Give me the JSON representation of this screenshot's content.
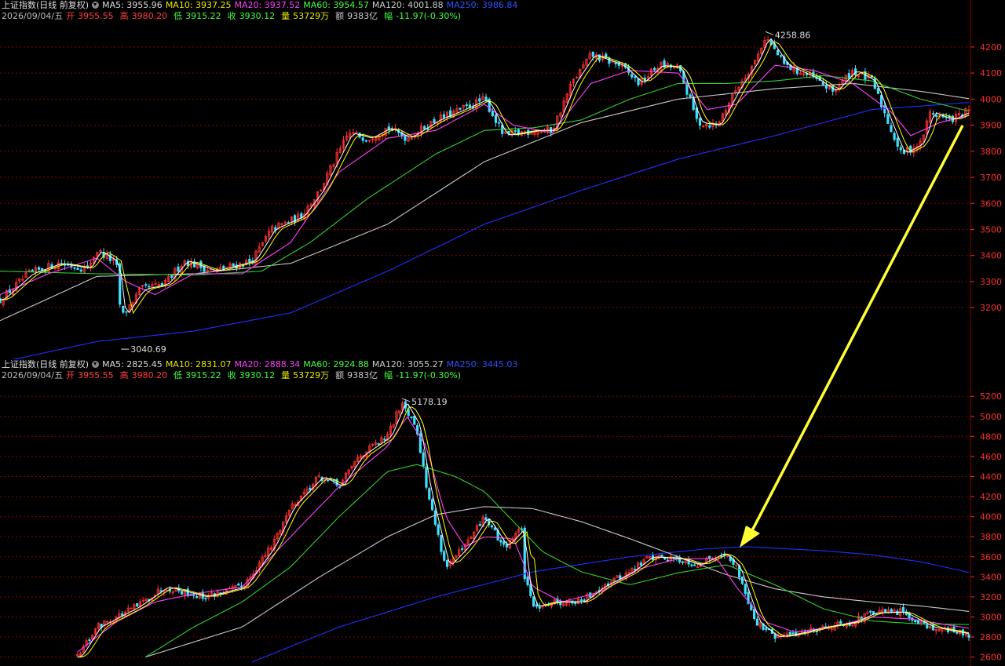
{
  "colors": {
    "background": "#000000",
    "up": "#ff3030",
    "down": "#40e0ff",
    "ma5": "#ffffff",
    "ma10": "#ffff00",
    "ma20": "#ff40ff",
    "ma60": "#30d030",
    "ma120": "#c8c8c8",
    "ma250": "#2030ff",
    "grid": "#8b0000",
    "axis_text": "#ff3030",
    "arrow": "#ffff33"
  },
  "panel1": {
    "title": "上证指数(日线 前复权)",
    "ma5": "MA5: 3955.96",
    "ma10": "MA10: 3937.25",
    "ma20": "MA20: 3937.52",
    "ma60": "MA60: 3954.57",
    "ma120": "MA120: 4001.88",
    "ma250": "MA250: 3986.84",
    "date": "2026/09/04/五",
    "open_label": "开",
    "open": "3955.55",
    "high_label": "高",
    "high": "3980.20",
    "low_label": "低",
    "low": "3915.22",
    "close_label": "收",
    "close": "3930.12",
    "vol_label": "量",
    "vol": "53729万",
    "amt_label": "额",
    "amt": "9383亿",
    "chg_label": "幅",
    "chg": "-11.97(-0.30%)",
    "max_label": "4258.86",
    "min_label": "3040.69"
  },
  "panel2": {
    "title": "上证指数(日线 前复权)",
    "ma5": "MA5: 2825.45",
    "ma10": "MA10: 2831.07",
    "ma20": "MA20: 2888.34",
    "ma60": "MA60: 2924.88",
    "ma120": "MA120: 3055.27",
    "ma250": "MA250: 3445.03",
    "date": "2026/09/04/五",
    "open_label": "开",
    "open": "3955.55",
    "high_label": "高",
    "high": "3980.20",
    "low_label": "低",
    "low": "3915.22",
    "close_label": "收",
    "close": "3930.12",
    "vol_label": "量",
    "vol": "53729万",
    "amt_label": "额",
    "amt": "9383亿",
    "chg_label": "幅",
    "chg": "-11.97(-0.30%)",
    "max_label": "5178.19"
  },
  "chart_data": [
    {
      "type": "candlestick",
      "title": "上证指数(日线 前复权)",
      "ylim": [
        3050,
        4290
      ],
      "yticks": [
        3200,
        3300,
        3400,
        3500,
        3600,
        3700,
        3800,
        3900,
        4000,
        4100,
        4200
      ],
      "ytick_labels": [
        "3200",
        "3300",
        "3400",
        "3500",
        "3600",
        "3700",
        "3800",
        "3900",
        "4000",
        "4100",
        "4200"
      ],
      "grid": true,
      "max_point": {
        "i": 0.79,
        "value": 4258.86,
        "label": "4258.86"
      },
      "min_point": {
        "i": 0.125,
        "value": 3040.69,
        "label": "3040.69"
      },
      "close_path": [
        [
          0,
          3230
        ],
        [
          0.03,
          3330
        ],
        [
          0.06,
          3370
        ],
        [
          0.09,
          3350
        ],
        [
          0.1,
          3420
        ],
        [
          0.12,
          3370
        ],
        [
          0.125,
          3160
        ],
        [
          0.145,
          3270
        ],
        [
          0.17,
          3290
        ],
        [
          0.19,
          3380
        ],
        [
          0.22,
          3340
        ],
        [
          0.26,
          3380
        ],
        [
          0.28,
          3500
        ],
        [
          0.31,
          3550
        ],
        [
          0.33,
          3650
        ],
        [
          0.36,
          3870
        ],
        [
          0.38,
          3850
        ],
        [
          0.4,
          3890
        ],
        [
          0.42,
          3850
        ],
        [
          0.45,
          3920
        ],
        [
          0.47,
          3950
        ],
        [
          0.5,
          4000
        ],
        [
          0.52,
          3860
        ],
        [
          0.55,
          3880
        ],
        [
          0.57,
          3880
        ],
        [
          0.59,
          4060
        ],
        [
          0.61,
          4170
        ],
        [
          0.64,
          4130
        ],
        [
          0.66,
          4060
        ],
        [
          0.68,
          4130
        ],
        [
          0.7,
          4120
        ],
        [
          0.71,
          4020
        ],
        [
          0.72,
          3910
        ],
        [
          0.74,
          3900
        ],
        [
          0.76,
          4040
        ],
        [
          0.78,
          4150
        ],
        [
          0.79,
          4240
        ],
        [
          0.81,
          4130
        ],
        [
          0.84,
          4080
        ],
        [
          0.86,
          4030
        ],
        [
          0.88,
          4110
        ],
        [
          0.9,
          4070
        ],
        [
          0.92,
          3880
        ],
        [
          0.93,
          3790
        ],
        [
          0.95,
          3830
        ],
        [
          0.96,
          3950
        ],
        [
          0.98,
          3920
        ],
        [
          1.0,
          3955
        ]
      ],
      "ma20_path": [
        [
          0,
          3250
        ],
        [
          0.05,
          3330
        ],
        [
          0.1,
          3390
        ],
        [
          0.13,
          3300
        ],
        [
          0.16,
          3250
        ],
        [
          0.2,
          3330
        ],
        [
          0.25,
          3330
        ],
        [
          0.3,
          3450
        ],
        [
          0.35,
          3720
        ],
        [
          0.4,
          3850
        ],
        [
          0.45,
          3880
        ],
        [
          0.5,
          3980
        ],
        [
          0.53,
          3900
        ],
        [
          0.57,
          3870
        ],
        [
          0.61,
          4060
        ],
        [
          0.65,
          4110
        ],
        [
          0.7,
          4100
        ],
        [
          0.73,
          3960
        ],
        [
          0.76,
          3980
        ],
        [
          0.8,
          4130
        ],
        [
          0.84,
          4110
        ],
        [
          0.88,
          4060
        ],
        [
          0.92,
          3950
        ],
        [
          0.94,
          3860
        ],
        [
          0.97,
          3910
        ],
        [
          1.0,
          3937
        ]
      ],
      "ma60_path": [
        [
          0,
          3340
        ],
        [
          0.1,
          3330
        ],
        [
          0.2,
          3325
        ],
        [
          0.27,
          3340
        ],
        [
          0.32,
          3450
        ],
        [
          0.38,
          3620
        ],
        [
          0.45,
          3790
        ],
        [
          0.5,
          3880
        ],
        [
          0.55,
          3890
        ],
        [
          0.6,
          3920
        ],
        [
          0.65,
          4000
        ],
        [
          0.7,
          4060
        ],
        [
          0.75,
          4060
        ],
        [
          0.8,
          4070
        ],
        [
          0.85,
          4090
        ],
        [
          0.9,
          4070
        ],
        [
          0.95,
          4000
        ],
        [
          1.0,
          3954
        ]
      ],
      "ma120_path": [
        [
          0,
          3150
        ],
        [
          0.1,
          3320
        ],
        [
          0.2,
          3330
        ],
        [
          0.3,
          3370
        ],
        [
          0.4,
          3520
        ],
        [
          0.5,
          3760
        ],
        [
          0.6,
          3910
        ],
        [
          0.7,
          4000
        ],
        [
          0.8,
          4040
        ],
        [
          0.88,
          4060
        ],
        [
          0.95,
          4030
        ],
        [
          1.0,
          4002
        ]
      ],
      "ma250_path": [
        [
          0,
          2990
        ],
        [
          0.1,
          3070
        ],
        [
          0.2,
          3110
        ],
        [
          0.3,
          3180
        ],
        [
          0.4,
          3340
        ],
        [
          0.5,
          3520
        ],
        [
          0.6,
          3650
        ],
        [
          0.7,
          3770
        ],
        [
          0.8,
          3860
        ],
        [
          0.9,
          3960
        ],
        [
          1.0,
          3987
        ]
      ]
    },
    {
      "type": "candlestick",
      "title": "上证指数(日线 前复权)",
      "ylim": [
        2550,
        5350
      ],
      "yticks": [
        2600,
        2800,
        3000,
        3200,
        3400,
        3600,
        3800,
        4000,
        4200,
        4400,
        4600,
        4800,
        5000,
        5200
      ],
      "ytick_labels": [
        "2600",
        "2800",
        "3000",
        "3200",
        "3400",
        "3600",
        "3800",
        "4000",
        "4200",
        "4400",
        "4600",
        "4800",
        "5000",
        "5200"
      ],
      "grid": true,
      "max_point": {
        "i": 0.415,
        "value": 5178.19,
        "label": "5178.19"
      },
      "close_path": [
        [
          0.08,
          2600
        ],
        [
          0.1,
          2900
        ],
        [
          0.12,
          3000
        ],
        [
          0.14,
          3100
        ],
        [
          0.17,
          3300
        ],
        [
          0.19,
          3250
        ],
        [
          0.21,
          3200
        ],
        [
          0.23,
          3250
        ],
        [
          0.25,
          3300
        ],
        [
          0.28,
          3700
        ],
        [
          0.3,
          4100
        ],
        [
          0.33,
          4400
        ],
        [
          0.35,
          4300
        ],
        [
          0.37,
          4600
        ],
        [
          0.4,
          4800
        ],
        [
          0.415,
          5150
        ],
        [
          0.43,
          4900
        ],
        [
          0.44,
          4300
        ],
        [
          0.45,
          3900
        ],
        [
          0.46,
          3500
        ],
        [
          0.48,
          3700
        ],
        [
          0.5,
          4000
        ],
        [
          0.52,
          3700
        ],
        [
          0.54,
          3900
        ],
        [
          0.53,
          3800
        ],
        [
          0.55,
          3100
        ],
        [
          0.57,
          3150
        ],
        [
          0.6,
          3150
        ],
        [
          0.62,
          3300
        ],
        [
          0.65,
          3450
        ],
        [
          0.67,
          3600
        ],
        [
          0.7,
          3580
        ],
        [
          0.72,
          3520
        ],
        [
          0.745,
          3640
        ],
        [
          0.76,
          3500
        ],
        [
          0.78,
          2950
        ],
        [
          0.8,
          2800
        ],
        [
          0.82,
          2830
        ],
        [
          0.85,
          2900
        ],
        [
          0.88,
          2950
        ],
        [
          0.9,
          3040
        ],
        [
          0.93,
          3050
        ],
        [
          0.96,
          2900
        ],
        [
          1.0,
          2825
        ]
      ],
      "ma20_path": [
        [
          0.08,
          2650
        ],
        [
          0.12,
          2950
        ],
        [
          0.16,
          3150
        ],
        [
          0.2,
          3230
        ],
        [
          0.25,
          3300
        ],
        [
          0.3,
          3800
        ],
        [
          0.35,
          4300
        ],
        [
          0.4,
          4700
        ],
        [
          0.42,
          5000
        ],
        [
          0.44,
          4700
        ],
        [
          0.46,
          4000
        ],
        [
          0.48,
          3700
        ],
        [
          0.5,
          3800
        ],
        [
          0.53,
          3780
        ],
        [
          0.55,
          3300
        ],
        [
          0.58,
          3150
        ],
        [
          0.62,
          3250
        ],
        [
          0.66,
          3480
        ],
        [
          0.7,
          3580
        ],
        [
          0.74,
          3580
        ],
        [
          0.76,
          3300
        ],
        [
          0.79,
          2950
        ],
        [
          0.82,
          2850
        ],
        [
          0.86,
          2900
        ],
        [
          0.9,
          3000
        ],
        [
          0.94,
          2980
        ],
        [
          1.0,
          2888
        ]
      ],
      "ma60_path": [
        [
          0.15,
          2600
        ],
        [
          0.2,
          2900
        ],
        [
          0.25,
          3150
        ],
        [
          0.3,
          3500
        ],
        [
          0.35,
          4000
        ],
        [
          0.4,
          4450
        ],
        [
          0.43,
          4520
        ],
        [
          0.47,
          4400
        ],
        [
          0.5,
          4250
        ],
        [
          0.53,
          3950
        ],
        [
          0.56,
          3650
        ],
        [
          0.6,
          3450
        ],
        [
          0.65,
          3320
        ],
        [
          0.7,
          3440
        ],
        [
          0.75,
          3520
        ],
        [
          0.8,
          3320
        ],
        [
          0.85,
          3080
        ],
        [
          0.9,
          2960
        ],
        [
          0.95,
          2930
        ],
        [
          1.0,
          2925
        ]
      ],
      "ma120_path": [
        [
          0.15,
          2600
        ],
        [
          0.25,
          2900
        ],
        [
          0.33,
          3400
        ],
        [
          0.4,
          3800
        ],
        [
          0.45,
          4020
        ],
        [
          0.5,
          4100
        ],
        [
          0.55,
          4080
        ],
        [
          0.6,
          3950
        ],
        [
          0.65,
          3780
        ],
        [
          0.7,
          3600
        ],
        [
          0.75,
          3420
        ],
        [
          0.8,
          3280
        ],
        [
          0.85,
          3200
        ],
        [
          0.9,
          3150
        ],
        [
          0.95,
          3110
        ],
        [
          1.0,
          3055
        ]
      ],
      "ma250_path": [
        [
          0.26,
          2550
        ],
        [
          0.35,
          2900
        ],
        [
          0.45,
          3200
        ],
        [
          0.55,
          3450
        ],
        [
          0.65,
          3600
        ],
        [
          0.73,
          3680
        ],
        [
          0.77,
          3700
        ],
        [
          0.85,
          3660
        ],
        [
          0.9,
          3620
        ],
        [
          0.95,
          3550
        ],
        [
          1.0,
          3445
        ]
      ]
    }
  ]
}
